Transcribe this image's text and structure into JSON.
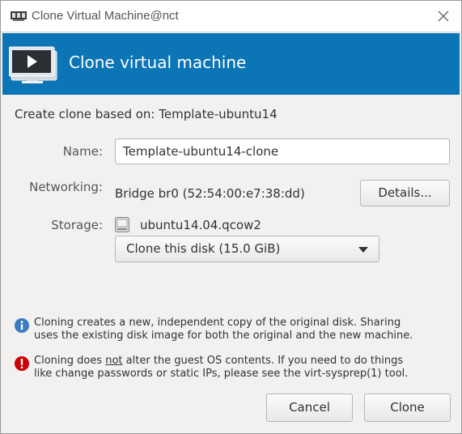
{
  "window": {
    "title": "Clone Virtual Machine@nct"
  },
  "banner": {
    "title": "Clone virtual machine"
  },
  "base": {
    "text": "Create clone based on: Template-ubuntu14"
  },
  "form": {
    "name_label": "Name:",
    "name_value": "Template-ubuntu14-clone",
    "networking_label": "Networking:",
    "networking_value": "Bridge br0 (52:54:00:e7:38:dd)",
    "details_button": "Details...",
    "storage_label": "Storage:",
    "storage_disk": "ubuntu14.04.qcow2",
    "storage_option": "Clone this disk (15.0 GiB)"
  },
  "notes": {
    "info_line1": "Cloning creates a new, independent copy of the original disk. Sharing",
    "info_line2": "uses the existing disk image for both the original and the new machine.",
    "warn_line1_a": "Cloning does ",
    "warn_line1_b": "not",
    "warn_line1_c": " alter the guest OS contents. If you need to do things",
    "warn_line2": "like change passwords or static IPs, please see the virt-sysprep(1) tool."
  },
  "actions": {
    "cancel": "Cancel",
    "clone": "Clone"
  },
  "colors": {
    "banner": "#0c75b5",
    "info_icon": "#3a7ac2",
    "warning_icon": "#cc0000"
  },
  "icons": {
    "app": "virt-manager-icon",
    "close": "close-icon",
    "banner": "monitor-play-icon",
    "disk": "disk-icon",
    "dropdown": "chevron-down-icon",
    "info": "info-icon",
    "warning": "warning-icon"
  }
}
